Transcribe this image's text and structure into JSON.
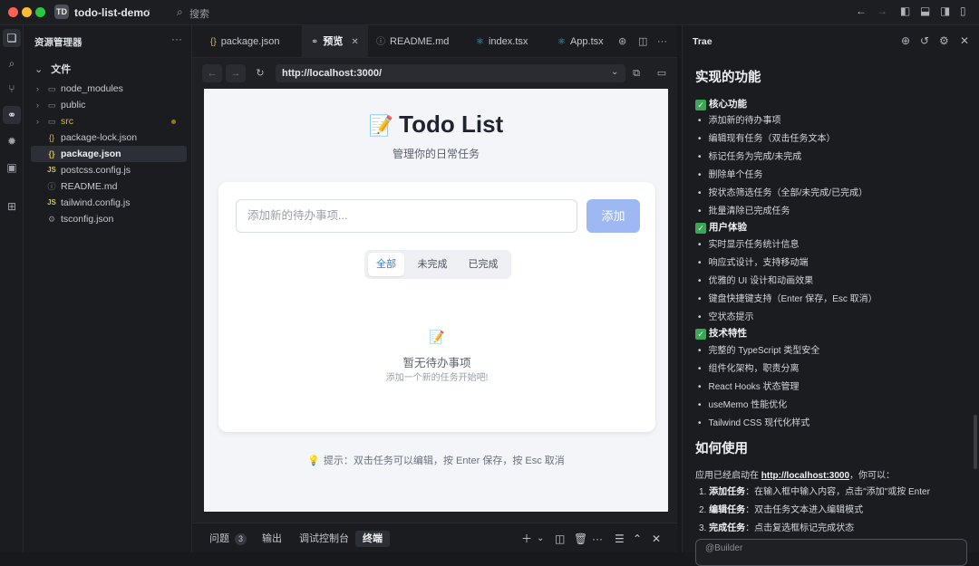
{
  "window": {
    "project_badge": "TD",
    "project_name": "todo-list-demo",
    "search_label": "搜索"
  },
  "explorer": {
    "title": "资源管理器",
    "root_label": "文件",
    "items": [
      {
        "name": "node_modules",
        "type": "folder"
      },
      {
        "name": "public",
        "type": "folder"
      },
      {
        "name": "src",
        "type": "folder"
      },
      {
        "name": "package-lock.json",
        "type": "json"
      },
      {
        "name": "package.json",
        "type": "json"
      },
      {
        "name": "postcss.config.js",
        "type": "js"
      },
      {
        "name": "README.md",
        "type": "info"
      },
      {
        "name": "tailwind.config.js",
        "type": "js"
      },
      {
        "name": "tsconfig.json",
        "type": "gear"
      }
    ]
  },
  "tabs": [
    {
      "label": "package.json",
      "icon": "json-icon"
    },
    {
      "label": "预览",
      "icon": "preview-icon"
    },
    {
      "label": "README.md",
      "icon": "info-icon"
    },
    {
      "label": "index.tsx",
      "icon": "react-icon"
    },
    {
      "label": "App.tsx",
      "icon": "react-icon"
    }
  ],
  "browser": {
    "url": "http://localhost:3000/"
  },
  "app": {
    "title_emoji": "📝",
    "title": "Todo List",
    "subtitle": "管理你的日常任务",
    "input_placeholder": "添加新的待办事项...",
    "add_button": "添加",
    "filters": [
      "全部",
      "未完成",
      "已完成"
    ],
    "active_filter": "全部",
    "empty_icon": "📝",
    "empty_title": "暂无待办事项",
    "empty_subtitle": "添加一个新的任务开始吧!",
    "hint_icon": "💡",
    "hint": "提示：双击任务可以编辑，按 Enter 保存，按 Esc 取消"
  },
  "panel": {
    "tabs": [
      {
        "label": "问题",
        "badge": "3"
      },
      {
        "label": "输出"
      },
      {
        "label": "调试控制台"
      },
      {
        "label": "终端"
      }
    ],
    "active": "终端"
  },
  "chat": {
    "title": "Trae",
    "features_heading": "实现的功能",
    "sections": [
      {
        "title": "核心功能",
        "items": [
          "添加新的待办事项",
          "编辑现有任务（双击任务文本）",
          "标记任务为完成/未完成",
          "删除单个任务",
          "按状态筛选任务（全部/未完成/已完成）",
          "批量清除已完成任务"
        ]
      },
      {
        "title": "用户体验",
        "items": [
          "实时显示任务统计信息",
          "响应式设计，支持移动端",
          "优雅的 UI 设计和动画效果",
          "键盘快捷键支持（Enter 保存，Esc 取消）",
          "空状态提示"
        ]
      },
      {
        "title": "技术特性",
        "items": [
          "完整的 TypeScript 类型安全",
          "组件化架构，职责分离",
          "React Hooks 状态管理",
          "useMemo 性能优化",
          "Tailwind CSS 现代化样式"
        ]
      }
    ],
    "usage_heading": "如何使用",
    "usage_intro_before": "应用已经启动在 ",
    "usage_url": "http://localhost:3000",
    "usage_intro_after": "，你可以：",
    "steps": [
      {
        "num": "1.",
        "bold": "添加任务",
        "text": "：在输入框中输入内容，点击\"添加\"或按 Enter"
      },
      {
        "num": "2.",
        "bold": "编辑任务",
        "text": "：双击任务文本进入编辑模式"
      },
      {
        "num": "3.",
        "bold": "完成任务",
        "text": "：点击复选框标记完成状态"
      }
    ],
    "compose_text": "@Builder"
  }
}
